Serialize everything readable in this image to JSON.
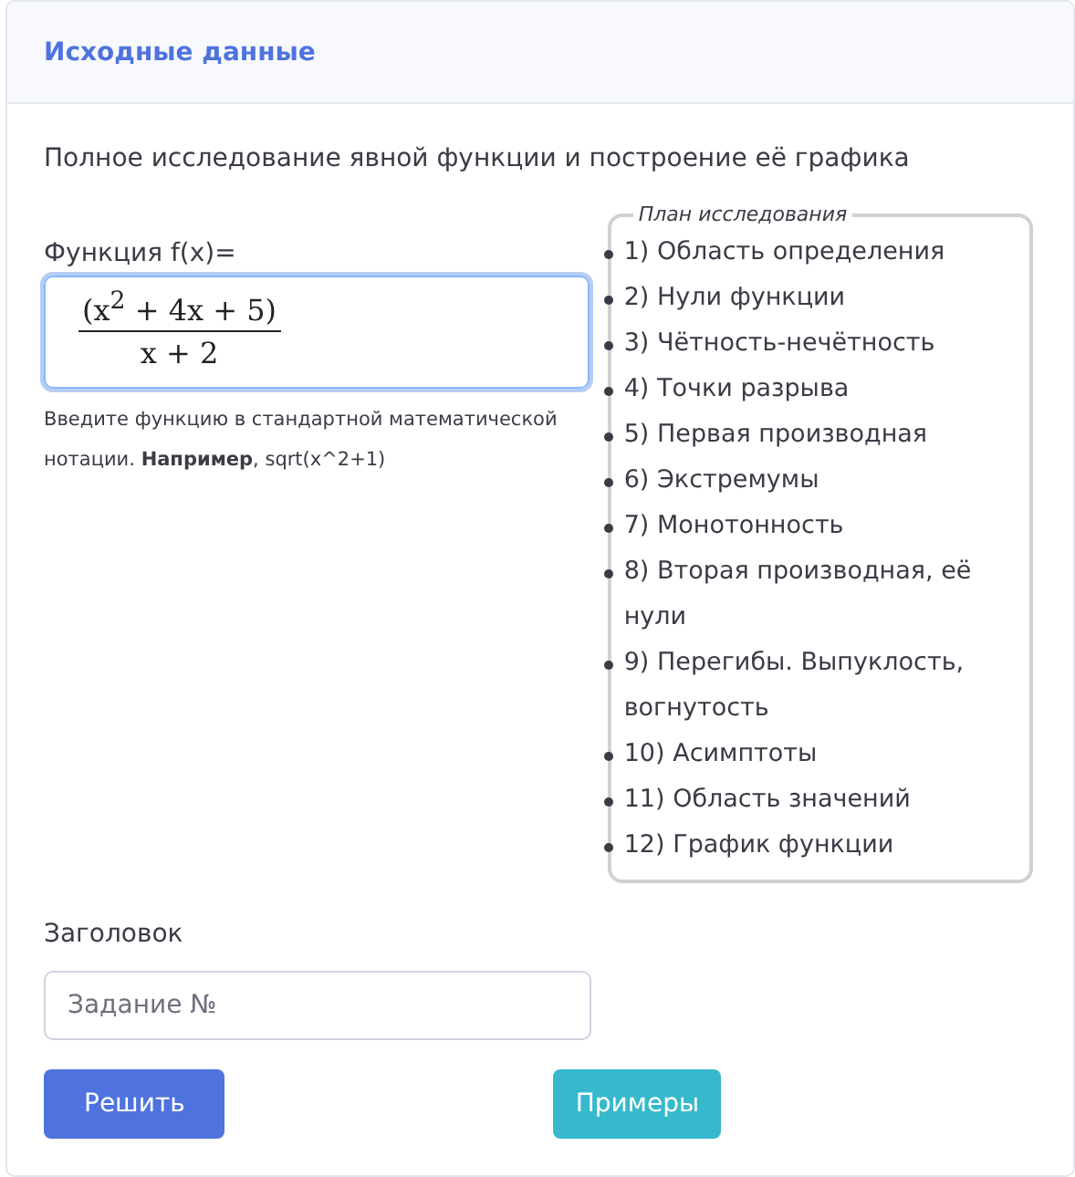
{
  "card": {
    "title": "Исходные данные"
  },
  "description": "Полное исследование явной функции и построение её графика",
  "function_field": {
    "label": "Функция f(x)=",
    "numerator": "(x$^{2}$ + 4x + 5)",
    "denominator": "x + 2",
    "focused": true
  },
  "hint": "Введите функцию в стандартной математической нотации. **Например**, sqrt(x^2+1)",
  "plan": {
    "legend": "План исследования",
    "items": [
      "1) Область определения",
      "2) Нули функции",
      "3) Чётность-нечётность",
      "4) Точки разрыва",
      "5) Первая производная",
      "6) Экстремумы",
      "7) Монотонность",
      "8) Вторая производная, её нули",
      "9) Перегибы. Выпуклость, вогнутость",
      "10) Асимптоты",
      "11) Область значений",
      "12) График функции"
    ]
  },
  "title_field": {
    "label": "Заголовок",
    "placeholder": "Задание №"
  },
  "buttons": [
    {
      "label": "Решить",
      "kind": "primary"
    },
    {
      "label": "Примеры",
      "kind": "info"
    }
  ]
}
